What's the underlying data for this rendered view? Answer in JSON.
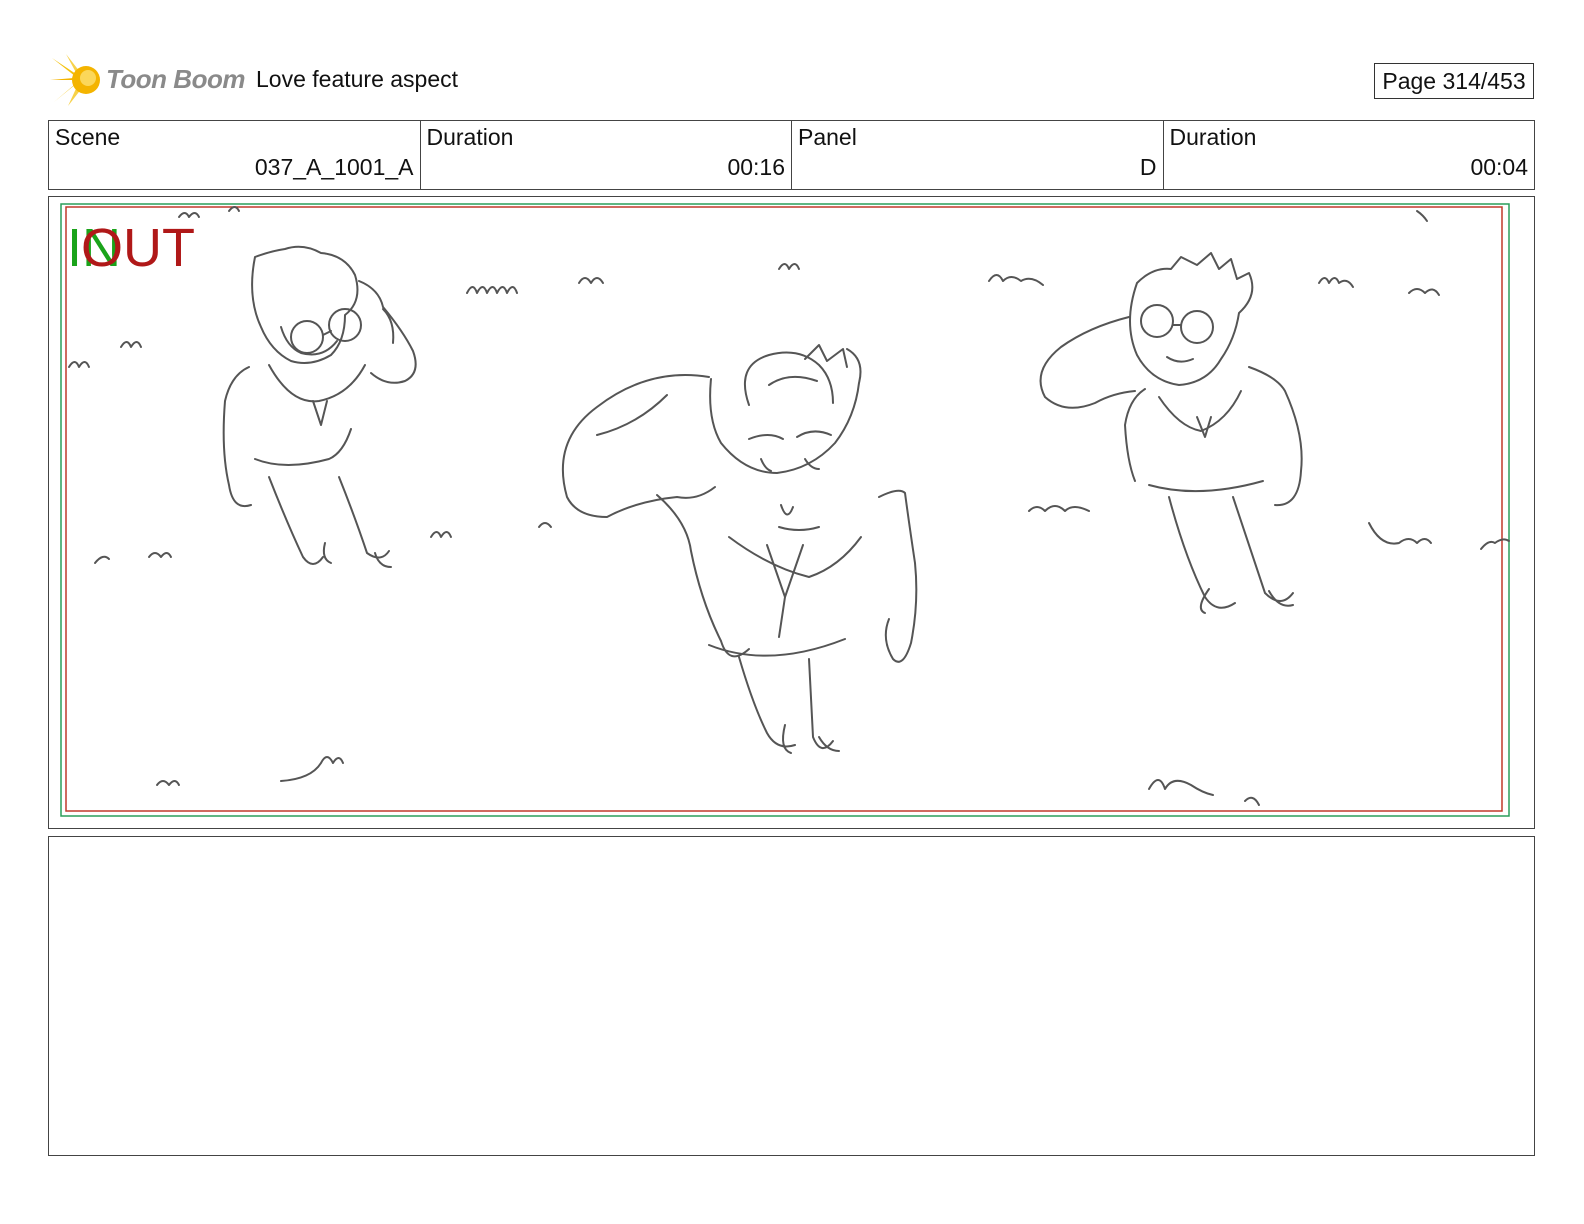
{
  "header": {
    "logo_text": "Toon Boom",
    "project_title": "Love feature aspect",
    "page_label": "Page 314/453"
  },
  "info": {
    "scene_label": "Scene",
    "scene_value": "037_A_1001_A",
    "scene_duration_label": "Duration",
    "scene_duration_value": "00:16",
    "panel_label": "Panel",
    "panel_value": "D",
    "panel_duration_label": "Duration",
    "panel_duration_value": "00:04"
  },
  "panel": {
    "in_label": "IN",
    "out_label": "OUT",
    "in_color": "#1aa31a",
    "out_color": "#b01818"
  },
  "notes": {
    "text": ""
  }
}
